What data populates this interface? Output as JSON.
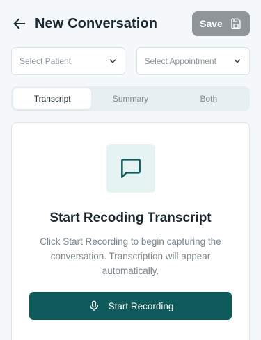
{
  "header": {
    "title": "New Conversation",
    "save_label": "Save"
  },
  "selects": {
    "patient_placeholder": "Select Patient",
    "appointment_placeholder": "Select Appointment"
  },
  "tabs": [
    {
      "label": "Transcript",
      "active": true
    },
    {
      "label": "Summary",
      "active": false
    },
    {
      "label": "Both",
      "active": false
    }
  ],
  "card": {
    "title": "Start Recoding Transcript",
    "description": "Click Start Recording to begin capturing the conversation. Transcription will appear automatically.",
    "button_label": "Start Recording"
  },
  "icons": {
    "back": "arrow-left-icon",
    "save": "floppy-disk-icon",
    "chevron": "chevron-down-icon",
    "message": "message-square-icon",
    "mic": "microphone-icon"
  },
  "colors": {
    "primary": "#0f5b5c",
    "save_button": "#8f9599",
    "icon_tile": "#e5f4f3",
    "background": "#f4f8fb"
  }
}
